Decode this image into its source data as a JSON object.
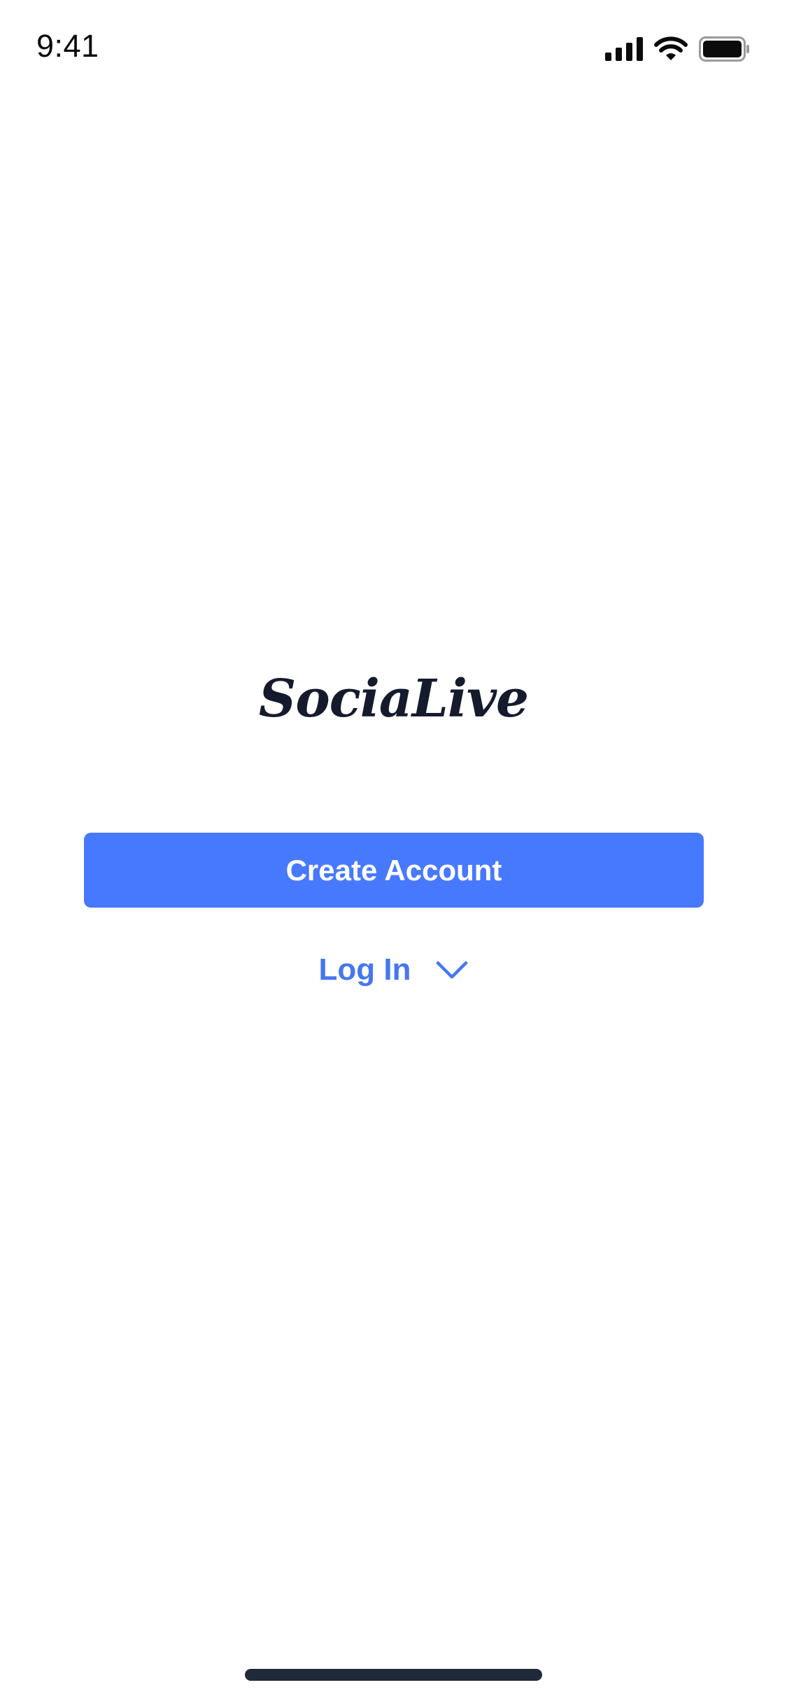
{
  "status_bar": {
    "time": "9:41",
    "icons": [
      "cellular-signal-icon",
      "wifi-icon",
      "battery-icon"
    ]
  },
  "logo": {
    "text": "SociaLive"
  },
  "actions": {
    "create_account_label": "Create Account",
    "login_label": "Log In",
    "login_icon": "chevron-down-icon"
  },
  "colors": {
    "primary": "#4779ff",
    "link": "#4677ef",
    "logo": "#151b2d",
    "home_indicator": "#1f2937"
  }
}
